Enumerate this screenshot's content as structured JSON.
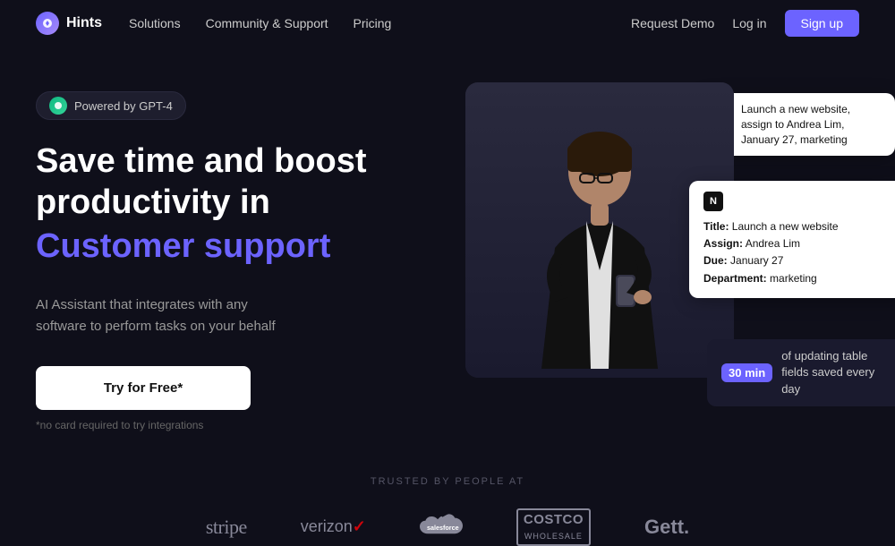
{
  "nav": {
    "logo_text": "Hints",
    "links": [
      {
        "label": "Solutions",
        "id": "solutions"
      },
      {
        "label": "Community & Support",
        "id": "community-support"
      },
      {
        "label": "Pricing",
        "id": "pricing"
      }
    ],
    "request_demo": "Request Demo",
    "login": "Log in",
    "signup": "Sign up"
  },
  "hero": {
    "gpt_badge": "Powered by GPT-4",
    "headline_line1": "Save time and boost",
    "headline_line2": "productivity in",
    "headline_highlight": "Customer support",
    "subtext_line1": "AI Assistant that integrates with any",
    "subtext_line2": "software to perform tasks on your behalf",
    "cta_button": "Try for Free*",
    "no_card_text": "*no card required to try integrations"
  },
  "chat_bubble_top": {
    "text": "Launch a new website, assign to Andrea Lim, January 27, marketing"
  },
  "notion_card": {
    "title_label": "Title:",
    "title_value": "Launch a new website",
    "assign_label": "Assign:",
    "assign_value": "Andrea Lim",
    "due_label": "Due:",
    "due_value": "January 27",
    "dept_label": "Department:",
    "dept_value": "marketing"
  },
  "time_badge": {
    "highlight": "30 min",
    "text": "of updating table fields saved every day"
  },
  "trusted": {
    "label": "TRUSTED BY PEOPLE AT",
    "logos": [
      "stripe",
      "verizon",
      "salesforce",
      "costco",
      "Gett."
    ]
  }
}
